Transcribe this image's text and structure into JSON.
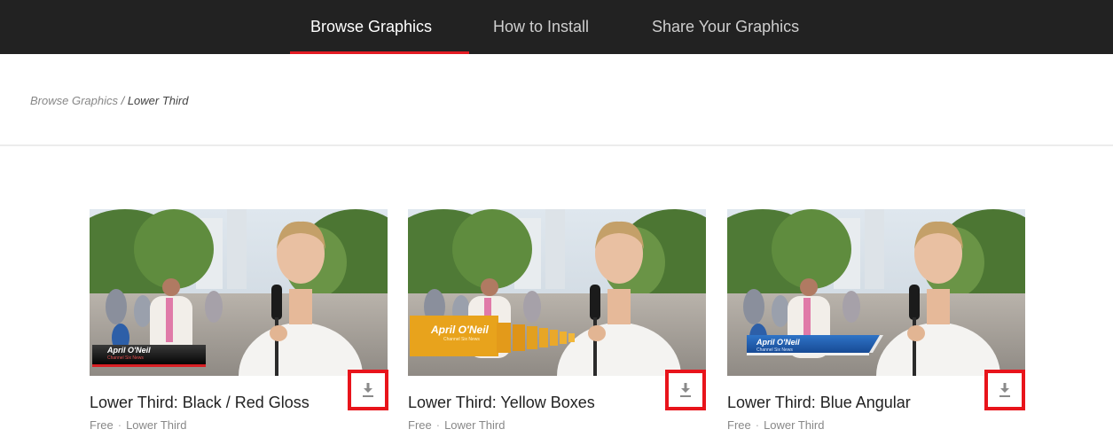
{
  "nav": {
    "tabs": [
      {
        "label": "Browse Graphics",
        "active": true
      },
      {
        "label": "How to Install",
        "active": false
      },
      {
        "label": "Share Your Graphics",
        "active": false
      }
    ],
    "accent": "#e31b23",
    "background": "#222222"
  },
  "breadcrumb": {
    "parent": "Browse Graphics",
    "separator": " / ",
    "current": "Lower Third"
  },
  "cards": [
    {
      "title": "Lower Third: Black / Red Gloss",
      "price": "Free",
      "category": "Lower Third",
      "overlay_name": "April O'Neil",
      "overlay_sub": "Channel Six News",
      "icon": "download-icon"
    },
    {
      "title": "Lower Third: Yellow Boxes",
      "price": "Free",
      "category": "Lower Third",
      "overlay_name": "April O'Neil",
      "overlay_sub": "Channel Six News",
      "icon": "download-icon"
    },
    {
      "title": "Lower Third: Blue Angular",
      "price": "Free",
      "category": "Lower Third",
      "overlay_name": "April O'Neil",
      "overlay_sub": "Channel Six News",
      "icon": "download-icon"
    }
  ],
  "meta_separator": "·",
  "highlight_color": "#e8141b"
}
